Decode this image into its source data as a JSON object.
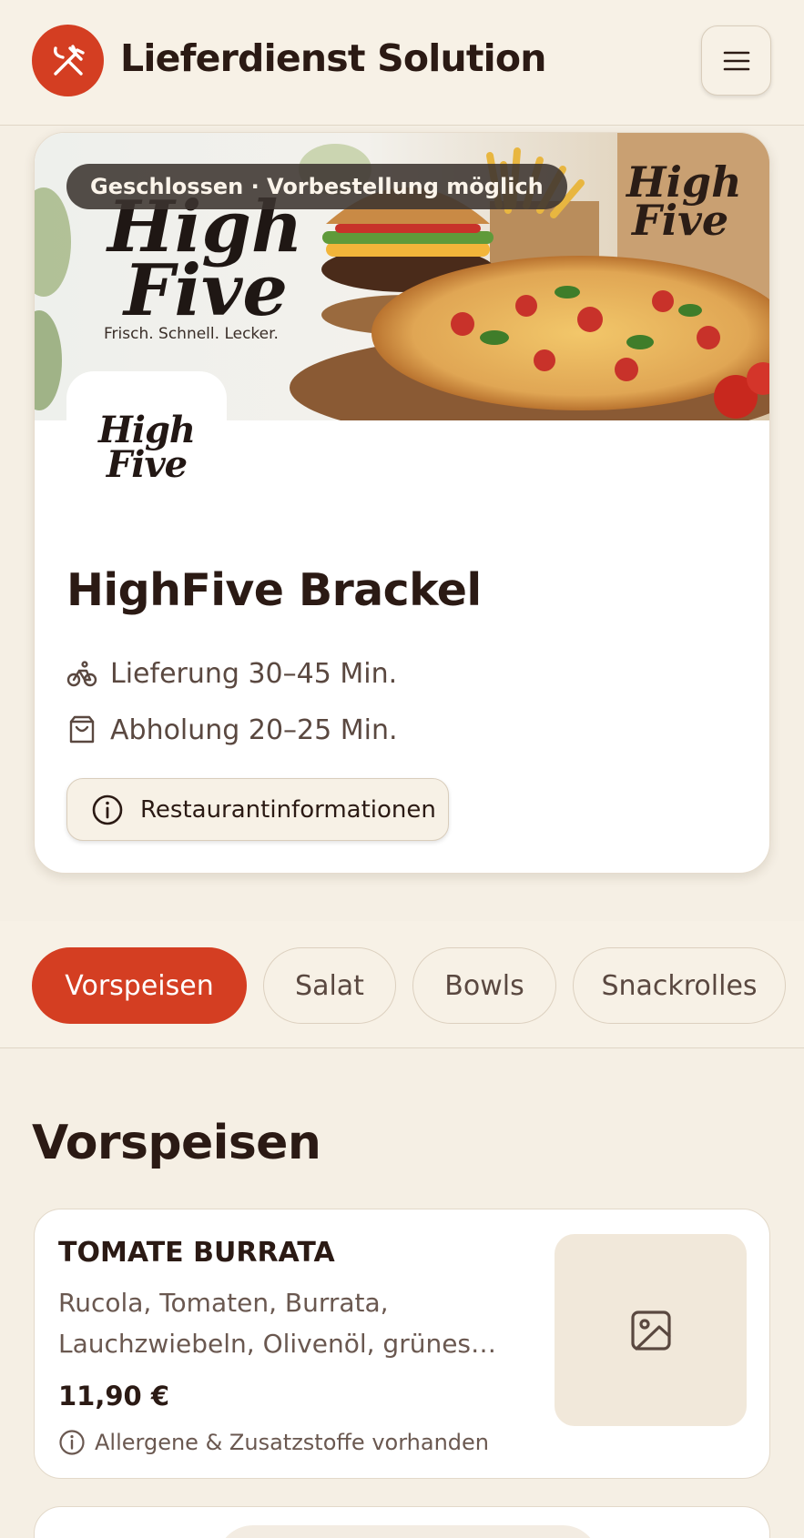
{
  "header": {
    "brand": "Lieferdienst Solution",
    "logo_icon": "fork-knife-crossed-icon",
    "menu_icon": "hamburger-menu-icon",
    "accent_color": "#d43e22"
  },
  "restaurant": {
    "status": "Geschlossen · Vorbestellung möglich",
    "hero_logo_line1": "High",
    "hero_logo_line2": "Five",
    "hero_tagline": "Frisch. Schnell. Lecker.",
    "hero_bag_line1": "High",
    "hero_bag_line2": "Five",
    "logo_line1": "High",
    "logo_line2": "Five",
    "name": "HighFive Brackel",
    "delivery": "Lieferung 30–45 Min.",
    "pickup": "Abholung 20–25 Min.",
    "info_button": "Restaurantinformationen"
  },
  "categories": {
    "items": [
      {
        "label": "Vorspeisen",
        "active": true
      },
      {
        "label": "Salat",
        "active": false
      },
      {
        "label": "Bowls",
        "active": false
      },
      {
        "label": "Snackrolles",
        "active": false
      }
    ]
  },
  "section": {
    "title": "Vorspeisen",
    "products": [
      {
        "name": "TOMATE BURRATA",
        "description_line1": "Rucola, Tomaten, Burrata,",
        "description_line2": "Lauchzwiebeln, Olivenöl, grünes…",
        "price": "11,90 €",
        "allergen_note": "Allergene & Zusatzstoffe vorhanden",
        "image_icon": "image-placeholder-icon"
      }
    ]
  }
}
